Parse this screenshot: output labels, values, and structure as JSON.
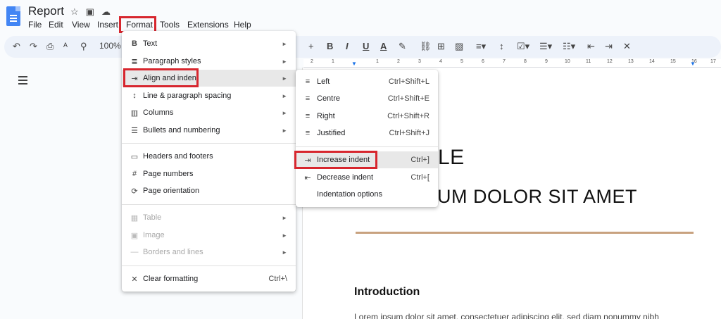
{
  "app": {
    "doc_title": "Report",
    "menus": [
      "File",
      "Edit",
      "View",
      "Insert",
      "Format",
      "Tools",
      "Extensions",
      "Help"
    ]
  },
  "toolbar": {
    "zoom": "100%",
    "bold": "B",
    "italic": "I",
    "underline": "U",
    "text_color": "A",
    "plus": "+"
  },
  "ruler": {
    "numbers": [
      "2",
      "1",
      "1",
      "2",
      "3",
      "4",
      "5",
      "6",
      "7",
      "8",
      "9",
      "10",
      "11",
      "12",
      "13",
      "14",
      "15",
      "16",
      "17"
    ]
  },
  "format_menu": {
    "items": [
      {
        "icon": "B",
        "label": "Text",
        "arrow": "►"
      },
      {
        "icon": "≣",
        "label": "Paragraph styles",
        "arrow": "►"
      },
      {
        "icon": "⇥",
        "label": "Align and indent",
        "arrow": "►"
      },
      {
        "icon": "↕",
        "label": "Line & paragraph spacing",
        "arrow": "►"
      },
      {
        "icon": "▥",
        "label": "Columns",
        "arrow": "►"
      },
      {
        "icon": "☰",
        "label": "Bullets and numbering",
        "arrow": "►"
      },
      {
        "icon": "▭",
        "label": "Headers and footers"
      },
      {
        "icon": "#",
        "label": "Page numbers"
      },
      {
        "icon": "⟳",
        "label": "Page orientation"
      },
      {
        "icon": "▦",
        "label": "Table",
        "arrow": "►"
      },
      {
        "icon": "▣",
        "label": "Image",
        "arrow": "►"
      },
      {
        "icon": "—",
        "label": "Borders and lines",
        "arrow": "►"
      },
      {
        "icon": "✕",
        "label": "Clear formatting",
        "shortcut": "Ctrl+\\"
      }
    ]
  },
  "align_menu": {
    "items": [
      {
        "icon": "≡",
        "label": "Left",
        "shortcut": "Ctrl+Shift+L"
      },
      {
        "icon": "≡",
        "label": "Centre",
        "shortcut": "Ctrl+Shift+E"
      },
      {
        "icon": "≡",
        "label": "Right",
        "shortcut": "Ctrl+Shift+R"
      },
      {
        "icon": "≡",
        "label": "Justified",
        "shortcut": "Ctrl+Shift+J"
      },
      {
        "icon": "⇥",
        "label": "Increase indent",
        "shortcut": "Ctrl+]"
      },
      {
        "icon": "⇤",
        "label": "Decrease indent",
        "shortcut": "Ctrl+["
      },
      {
        "label": "Indentation options"
      }
    ]
  },
  "document": {
    "title_fragment": "LE",
    "subtitle_fragment": "UM DOLOR SIT AMET",
    "heading": "Introduction",
    "body_fragment": "Lorem ipsum dolor sit amet, consectetuer adipiscing elit, sed diam nonummy nibh euismod"
  },
  "colors": {
    "highlight": "#d7262e",
    "accent_rule": "#c8a27f",
    "docs_blue": "#4285f4"
  }
}
